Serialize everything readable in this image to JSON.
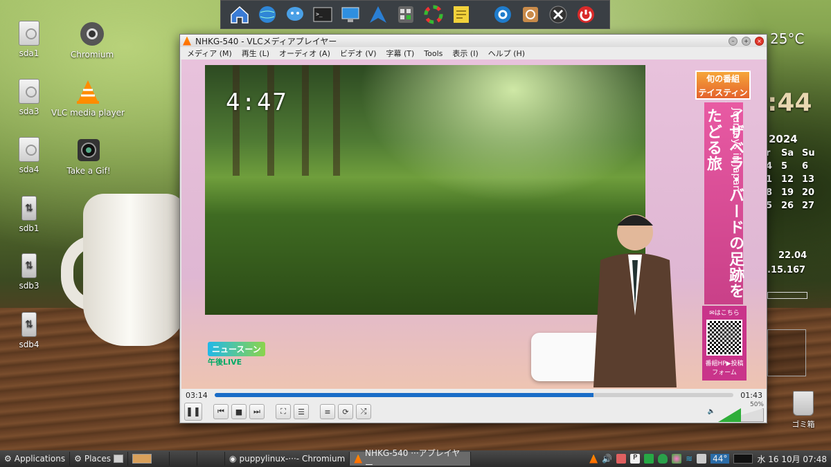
{
  "desktop": {
    "icons": [
      {
        "label": "sda1"
      },
      {
        "label": "Chromium"
      },
      {
        "label": "sda3"
      },
      {
        "label": "VLC media player"
      },
      {
        "label": "sda4"
      },
      {
        "label": "Take a Gif!"
      },
      {
        "label": "sdb1"
      },
      {
        "label": "sdb3"
      },
      {
        "label": "sdb4"
      }
    ],
    "trash_label": "ゴミ箱"
  },
  "widgets": {
    "temperature": "25°C",
    "clock_minutes": ":44",
    "year": "2024",
    "cal_header": [
      "r",
      "Sa",
      "Su"
    ],
    "cal_rows": [
      [
        "4",
        "5",
        "6"
      ],
      [
        "1",
        "12",
        "13"
      ],
      [
        "8",
        "19",
        "20"
      ],
      [
        "5",
        "26",
        "27"
      ]
    ],
    "net1": "22.04",
    "net2": ".15.167"
  },
  "vlc": {
    "title": "NHKG-540 - VLCメディアプレイヤー",
    "menu": [
      "メディア (M)",
      "再生 (L)",
      "オーディオ (A)",
      "ビデオ (V)",
      "字幕 (T)",
      "Tools",
      "表示 (I)",
      "ヘルプ (H)"
    ],
    "video": {
      "countdown": "4:47",
      "tag": "旬の番組\nテイスティング",
      "banner_jp": "イザベラ・バードの足跡をたどる旅",
      "banner_en": "Journeys in Japan",
      "qr_top": "✉はこちら",
      "qr_bottom": "番組HP▶投稿フォーム",
      "logo_box": "ニュースーン",
      "logo_sub": "午後LIVE"
    },
    "elapsed": "03:14",
    "remaining": "01:43",
    "progress": 0.73,
    "volume_percent": "50%",
    "volume": 0.5
  },
  "taskbar": {
    "apps_label": "Applications",
    "places_label": "Places",
    "items": [
      "puppylinux-···- Chromium",
      "NHKG-540 ···アプレイヤー"
    ],
    "temp": "44°",
    "datetime": "水 16 10月 07:48"
  },
  "colors": {
    "accent": "#1a6cc7",
    "vlc_orange": "#ff8c00",
    "banner_pink": "#e85aa3"
  }
}
